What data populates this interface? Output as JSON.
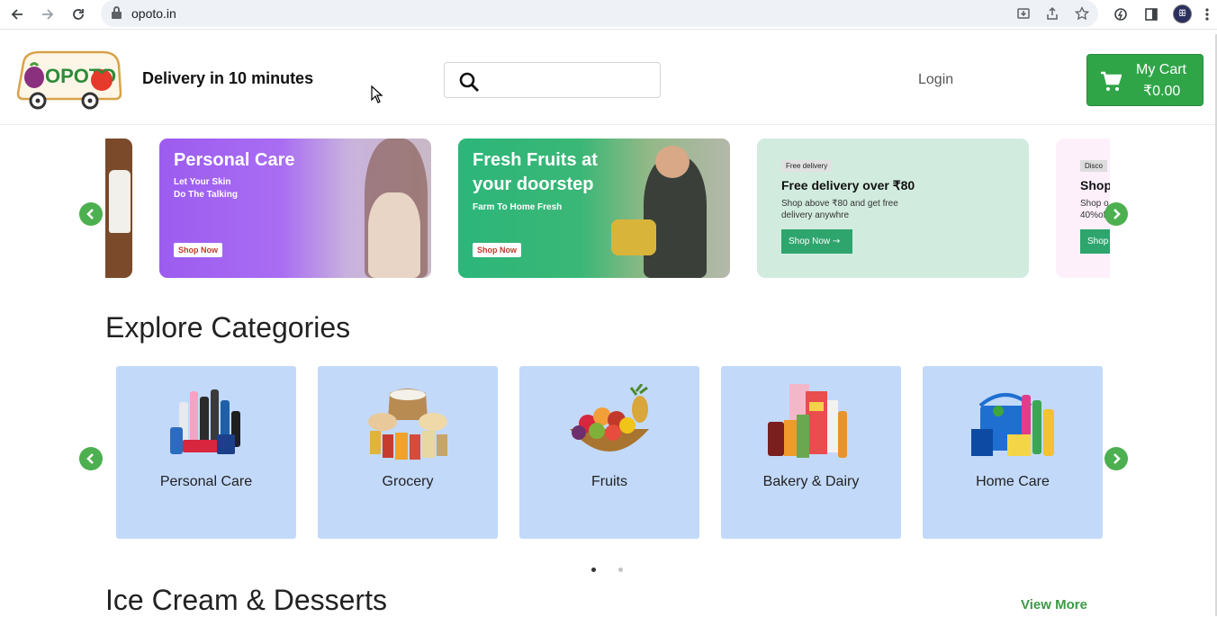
{
  "browser": {
    "url": "opoto.in",
    "avatar_glyph": "ꕥ"
  },
  "header": {
    "logo_text": "OPOTO",
    "delivery_text": "Delivery in 10 minutes",
    "search_placeholder": "",
    "login_label": "Login",
    "cart_label": "My Cart",
    "cart_total": "₹0.00"
  },
  "banners": [
    {
      "title": "Personal Care",
      "subtitle_line1": "Let Your Skin",
      "subtitle_line2": "Do The Talking",
      "button": "Shop Now"
    },
    {
      "title_line1": "Fresh Fruits at",
      "title_line2": "your doorstep",
      "subtitle": "Farm To Home Fresh",
      "button": "Shop Now"
    },
    {
      "tag": "Free delivery",
      "title": "Free delivery over  ₹80",
      "subtitle": "Shop above ₹80 and get free delivery anywhre",
      "button": "Shop Now"
    },
    {
      "tag": "Disco",
      "title": "Shop",
      "subtitle_line1": "Shop o",
      "subtitle_line2": "40%of",
      "button": "Shop"
    }
  ],
  "categories": {
    "title": "Explore Categories",
    "items": [
      {
        "label": "Personal Care"
      },
      {
        "label": "Grocery"
      },
      {
        "label": "Fruits"
      },
      {
        "label": "Bakery & Dairy"
      },
      {
        "label": "Home Care"
      }
    ]
  },
  "ice_cream": {
    "title": "Ice Cream & Desserts",
    "view_more": "View More"
  },
  "colors": {
    "accent_green": "#2fa548",
    "arrow_green": "#4caf50",
    "card_blue": "#c2d9fa"
  }
}
